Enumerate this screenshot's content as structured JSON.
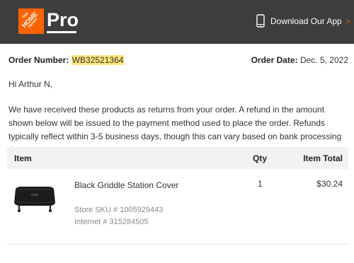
{
  "header": {
    "logo": {
      "line1": "THE",
      "line2": "HOME",
      "line3": "DEPOT",
      "color": "#f96302"
    },
    "brand_suffix": "Pro",
    "app_link_label": "Download Our App",
    "app_link_chevron": ">",
    "background": "#3d3d3d"
  },
  "order": {
    "number_label": "Order Number:",
    "number_value": "WB32521364",
    "date_label": "Order Date:",
    "date_value": "Dec. 5, 2022"
  },
  "greeting": "Hi Arthur N,",
  "message": "We have received these products as returns from your order. A refund in the amount shown below will be issued to the payment method used to place the order. Refunds typically reflect within 3-5 business days, though this can vary based on bank processing times.",
  "table": {
    "headers": {
      "item": "Item",
      "qty": "Qty",
      "total": "Item Total"
    },
    "rows": [
      {
        "name": "Black Griddle Station Cover",
        "qty": "1",
        "total": "$30.24",
        "store_sku": "Store SKU # 1005929443",
        "internet": "Internet # 315284505",
        "image_icon": "griddle-cover-image"
      }
    ]
  }
}
